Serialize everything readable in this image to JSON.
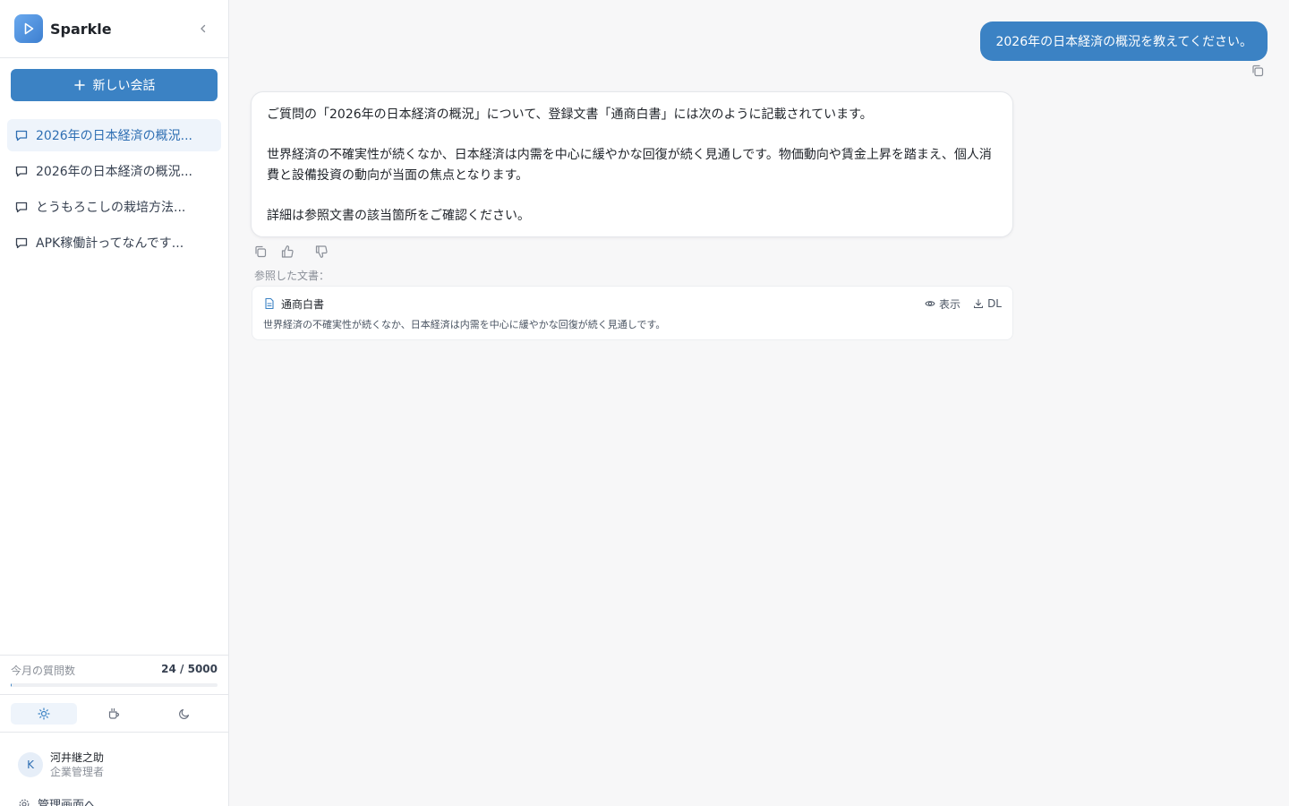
{
  "app": {
    "name": "Sparkle"
  },
  "sidebar": {
    "new_chat_label": "新しい会話",
    "conversations": [
      {
        "title": "2026年の日本経済の概況...",
        "active": true
      },
      {
        "title": "2026年の日本経済の概況...",
        "active": false
      },
      {
        "title": "とうもろこしの栽培方法...",
        "active": false
      },
      {
        "title": "APK稼働計ってなんです...",
        "active": false
      }
    ],
    "usage": {
      "label": "今月の質問数",
      "count": "24 / 5000",
      "used": 24,
      "limit": 5000
    },
    "themes": [
      {
        "name": "light",
        "icon": "sun-icon",
        "active": true
      },
      {
        "name": "coffee",
        "icon": "coffee-cup-icon",
        "active": false
      },
      {
        "name": "dark",
        "icon": "moon-icon",
        "active": false
      }
    ],
    "user": {
      "initial": "K",
      "name": "河井継之助",
      "role": "企業管理者"
    },
    "admin_link": "管理画面へ"
  },
  "chat": {
    "user_message": "2026年の日本経済の概況を教えてください。",
    "answer": {
      "p1": "ご質問の「2026年の日本経済の概況」について、登録文書「通商白書」には次のように記載されています。",
      "p2": "世界経済の不確実性が続くなか、日本経済は内需を中心に緩やかな回復が続く見通しです。物価動向や賃金上昇を踏まえ、個人消費と設備投資の動向が当面の焦点となります。",
      "p3": "詳細は参照文書の該当箇所をご確認ください。"
    },
    "references_label": "参照した文書：",
    "reference": {
      "name": "通商白書",
      "view_label": "表示",
      "download_label": "DL",
      "excerpt": "世界経済の不確実性が続くなか、日本経済は内需を中心に緩やかな回復が続く見通しです。"
    }
  },
  "colors": {
    "accent": "#3b82c4",
    "active_bg": "#eef4fb",
    "background": "#f7f7f8"
  }
}
